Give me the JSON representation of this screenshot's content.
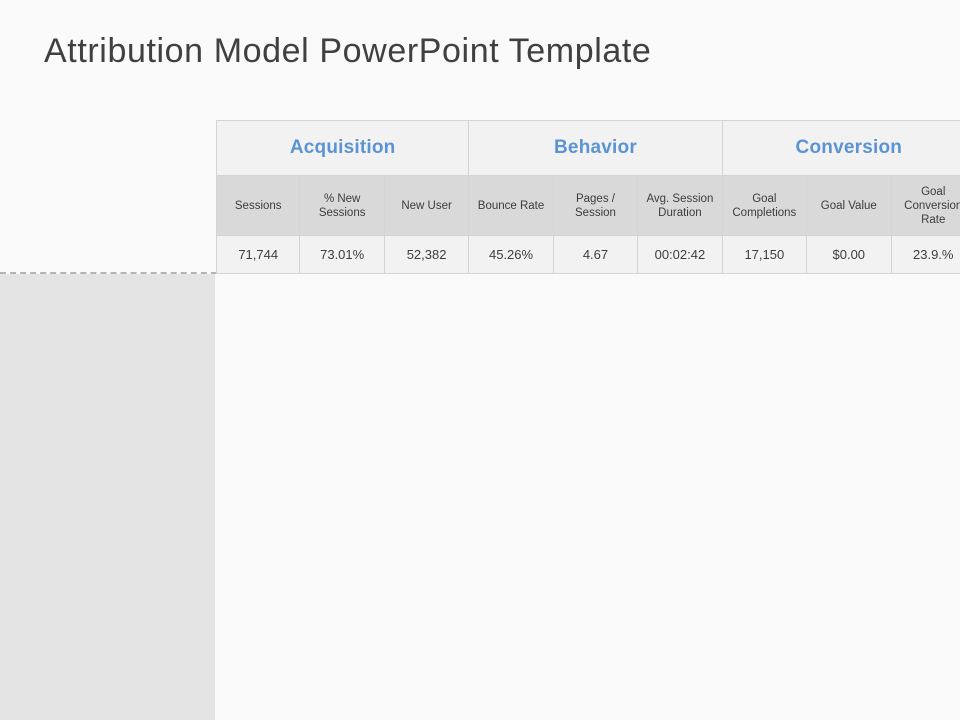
{
  "slide": {
    "title": "Attribution Model PowerPoint Template",
    "background_color": "#fafafa",
    "left_panel_color": "#e4e4e4",
    "guide_line_color": "#b4b4b4"
  },
  "table": {
    "accent_color": "#5b93d3",
    "group_header_bg": "#f2f2f2",
    "column_header_bg": "#d9d9d9",
    "data_row_bg": "#f2f2f2",
    "border_color": "#d4d4d4",
    "groups": [
      {
        "label": "Acquisition",
        "span": 3
      },
      {
        "label": "Behavior",
        "span": 3
      },
      {
        "label": "Conversion",
        "span": 3
      }
    ],
    "columns": [
      "Sessions",
      "% New Sessions",
      "New User",
      "Bounce Rate",
      "Pages / Session",
      "Avg. Session Duration",
      "Goal Completions",
      "Goal Value",
      "Goal Conversion Rate"
    ],
    "rows": [
      [
        "71,744",
        "73.01%",
        "52,382",
        "45.26%",
        "4.67",
        "00:02:42",
        "17,150",
        "$0.00",
        "23.9.%"
      ]
    ]
  }
}
